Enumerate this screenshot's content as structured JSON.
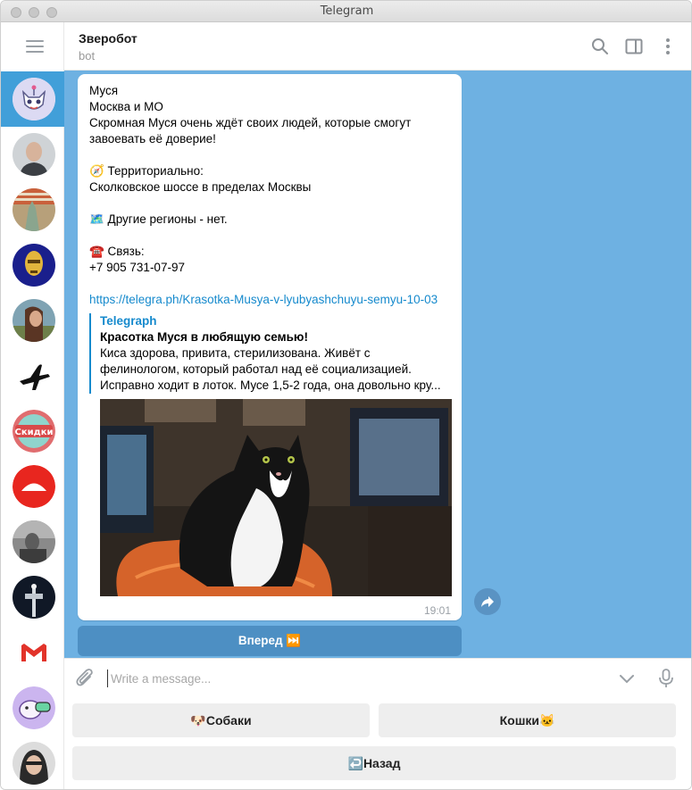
{
  "window": {
    "title": "Telegram"
  },
  "sidebar": {
    "chats": [
      {
        "name": "zverobot-avatar",
        "active": true
      },
      {
        "name": "contact-avatar-1"
      },
      {
        "name": "contact-avatar-2"
      },
      {
        "name": "contact-avatar-3"
      },
      {
        "name": "contact-avatar-4"
      },
      {
        "name": "airplane-channel-avatar"
      },
      {
        "name": "skidki-channel-avatar"
      },
      {
        "name": "red-channel-avatar"
      },
      {
        "name": "contact-avatar-5"
      },
      {
        "name": "contact-avatar-6"
      },
      {
        "name": "gmail-avatar"
      },
      {
        "name": "contact-avatar-7"
      },
      {
        "name": "contact-avatar-8"
      }
    ],
    "skidki_label": "Скидки"
  },
  "header": {
    "title": "Зверобот",
    "subtitle": "bot"
  },
  "message": {
    "lines": [
      "Муся",
      "Москва и МО",
      "Скромная Муся очень ждёт своих людей, которые смогут",
      "завоевать её доверие!",
      "",
      "🧭 Территориально:",
      "Сколковское шоссе в пределах Москвы",
      "",
      "🗺️ Другие регионы - нет.",
      "",
      "☎️ Связь:",
      "+7 905 731-07-97",
      ""
    ],
    "link": "https://telegra.ph/Krasotka-Musya-v-lyubyashchuyu-semyu-10-03",
    "preview": {
      "site": "Telegraph",
      "title": "Красотка Муся в любящую семью!",
      "desc_lines": [
        "Киса здорова, привита, стерилизована. Живёт с",
        "фелинологом, который работал над её социализацией.",
        "Исправно ходит в лоток.  Мусе 1,5-2 года, она довольно кру..."
      ]
    },
    "time": "19:01"
  },
  "inline_button": {
    "label": "Вперед ⏭️"
  },
  "input": {
    "placeholder": "Write a message..."
  },
  "keyboard": {
    "row1": [
      "🐶Собаки",
      "Кошки🐱"
    ],
    "row2": [
      "↩️Назад"
    ]
  },
  "colors": {
    "accent": "#419fd9",
    "chat_background": "#6eb1e2",
    "link": "#168acd",
    "inline_button": "#4d8fc3"
  }
}
